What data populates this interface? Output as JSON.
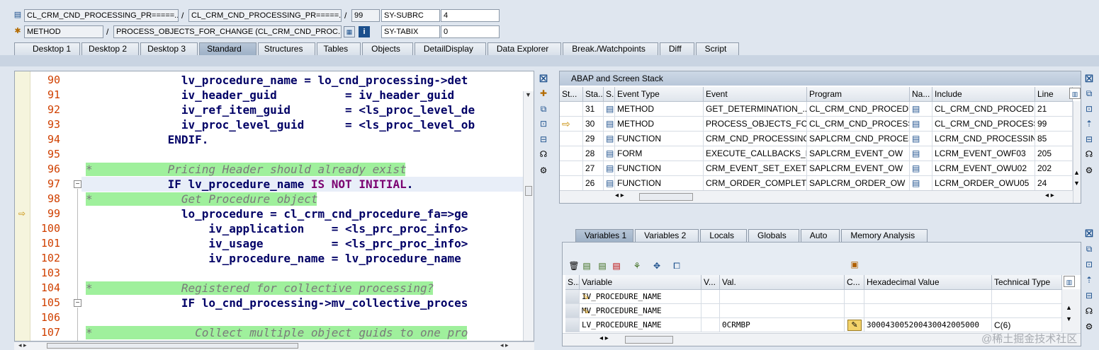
{
  "header": {
    "row1": {
      "program": "CL_CRM_CND_PROCESSING_PR=====...",
      "include": "CL_CRM_CND_PROCESSING_PR=====...",
      "line": "99",
      "sysvar": "SY-SUBRC",
      "sysval": "4"
    },
    "row2": {
      "type": "METHOD",
      "event": "PROCESS_OBJECTS_FOR_CHANGE (CL_CRM_CND_PROC...",
      "sysvar": "SY-TABIX",
      "sysval": "0"
    },
    "slash": "/"
  },
  "tabs": [
    "Desktop 1",
    "Desktop 2",
    "Desktop 3",
    "Standard",
    "Structures",
    "Tables",
    "Objects",
    "DetailDisplay",
    "Data Explorer",
    "Break./Watchpoints",
    "Diff",
    "Script"
  ],
  "active_tab": "Standard",
  "editor": {
    "lines": [
      {
        "n": "90",
        "text": "              lv_procedure_name = lo_cnd_processing->det",
        "cls": "b"
      },
      {
        "n": "91",
        "text": "              iv_header_guid          = iv_header_guid",
        "cls": "b"
      },
      {
        "n": "92",
        "text": "              iv_ref_item_guid        = <ls_proc_level_de",
        "cls": "b"
      },
      {
        "n": "93",
        "text": "              iv_proc_level_guid      = <ls_proc_level_ob",
        "cls": "b"
      },
      {
        "n": "94",
        "text": "            ENDIF.",
        "cls": "b"
      },
      {
        "n": "95",
        "text": "",
        "cls": "b"
      },
      {
        "n": "96",
        "text": "*           Pricing Header should already exist",
        "cls": "cm"
      },
      {
        "n": "97",
        "text": "            IF lv_procedure_name IS NOT INITIAL.",
        "cls": "b"
      },
      {
        "n": "98",
        "text": "*             Get Procedure object",
        "cls": "cm"
      },
      {
        "n": "99",
        "text": "              lo_procedure = cl_crm_cnd_procedure_fa=>ge",
        "cls": "b"
      },
      {
        "n": "100",
        "text": "                  iv_application    = <ls_prc_proc_info>",
        "cls": "b"
      },
      {
        "n": "101",
        "text": "                  iv_usage          = <ls_prc_proc_info>",
        "cls": "b"
      },
      {
        "n": "102",
        "text": "                  iv_procedure_name = lv_procedure_name",
        "cls": "b"
      },
      {
        "n": "103",
        "text": "",
        "cls": "b"
      },
      {
        "n": "104",
        "text": "*             Registered for collective processing?",
        "cls": "cm"
      },
      {
        "n": "105",
        "text": "              IF lo_cnd_processing->mv_collective_proces",
        "cls": "b"
      },
      {
        "n": "106",
        "text": "",
        "cls": "b"
      },
      {
        "n": "107",
        "text": "*               Collect multiple object guids to one pro",
        "cls": "cm"
      }
    ]
  },
  "stack": {
    "title": "ABAP and Screen Stack",
    "headers": [
      "St...",
      "Sta...",
      "S...",
      "Event Type",
      "Event",
      "Program",
      "Na...",
      "Include",
      "Line"
    ],
    "rows": [
      {
        "cur": "",
        "level": "31",
        "type": "METHOD",
        "event": "GET_DETERMINATION_...",
        "program": "CL_CRM_CND_PROCEDU...",
        "include": "CL_CRM_CND_PROCEDU...",
        "line": "21"
      },
      {
        "cur": "⇨",
        "level": "30",
        "type": "METHOD",
        "event": "PROCESS_OBJECTS_FOR...",
        "program": "CL_CRM_CND_PROCESSI...",
        "include": "CL_CRM_CND_PROCESSI...",
        "line": "99"
      },
      {
        "cur": "",
        "level": "29",
        "type": "FUNCTION",
        "event": "CRM_CND_PROCESSING_...",
        "program": "SAPLCRM_CND_PROCES...",
        "include": "LCRM_CND_PROCESSING...",
        "line": "85"
      },
      {
        "cur": "",
        "level": "28",
        "type": "FORM",
        "event": "EXECUTE_CALLBACKS_P...",
        "program": "SAPLCRM_EVENT_OW",
        "include": "LCRM_EVENT_OWF03",
        "line": "205"
      },
      {
        "cur": "",
        "level": "27",
        "type": "FUNCTION",
        "event": "CRM_EVENT_SET_EXETI...",
        "program": "SAPLCRM_EVENT_OW",
        "include": "LCRM_EVENT_OWU02",
        "line": "202"
      },
      {
        "cur": "",
        "level": "26",
        "type": "FUNCTION",
        "event": "CRM_ORDER_COMPLETE...",
        "program": "SAPLCRM_ORDER_OW",
        "include": "LCRM_ORDER_OWU05",
        "line": "24"
      }
    ]
  },
  "var_tabs": [
    "Variables 1",
    "Variables 2",
    "Locals",
    "Globals",
    "Auto",
    "Memory Analysis"
  ],
  "active_var_tab": "Variables 1",
  "variables": {
    "headers": [
      "S...",
      "Variable",
      "V...",
      "Val.",
      "C...",
      "Hexadecimal Value",
      "Technical Type"
    ],
    "rows": [
      {
        "name": "IV_PROCEDURE_NAME",
        "value": "",
        "hex": "",
        "type": ""
      },
      {
        "name": "MV_PROCEDURE_NAME",
        "value": "",
        "hex": "",
        "type": ""
      },
      {
        "name": "LV_PROCEDURE_NAME",
        "value": "0CRMBP",
        "hex": "300043005200430042005000",
        "type": "C(6)"
      }
    ]
  },
  "watermark": "@稀土掘金技术社区"
}
